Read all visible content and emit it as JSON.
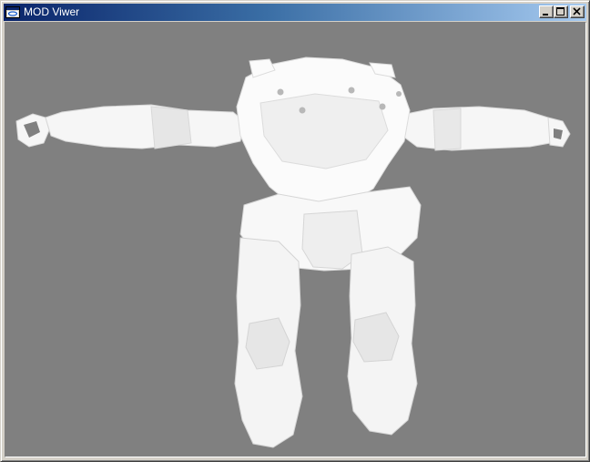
{
  "window": {
    "title": "MOD Viwer",
    "icon": "app-window-icon"
  },
  "title_controls": [
    {
      "name": "minimize-button",
      "icon": "minimize-icon"
    },
    {
      "name": "maximize-button",
      "icon": "maximize-icon"
    },
    {
      "name": "close-button",
      "icon": "close-icon"
    }
  ],
  "colors": {
    "title_active_start": "#0a246a",
    "title_active_end": "#a6caf0",
    "viewport_background": "#808080",
    "model_fill": "#ffffff"
  },
  "viewport": {
    "content": "3d-robot-model"
  }
}
